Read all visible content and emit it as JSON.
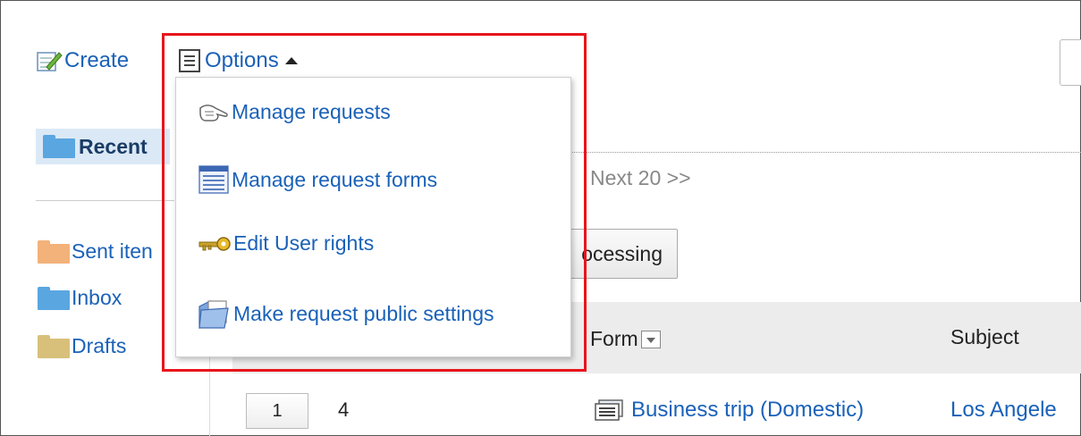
{
  "toolbar": {
    "create_label": "Create",
    "options_label": "Options"
  },
  "options_menu": {
    "items": [
      {
        "label": "Manage requests",
        "icon": "hand-pointer-icon"
      },
      {
        "label": "Manage request forms",
        "icon": "form-icon"
      },
      {
        "label": "Edit User rights",
        "icon": "key-icon"
      },
      {
        "label": "Make request public settings",
        "icon": "public-folder-icon"
      }
    ]
  },
  "sidebar": {
    "selected": "Recent",
    "items": [
      {
        "label": "Sent iten",
        "icon": "orange-folder-icon"
      },
      {
        "label": "Inbox",
        "icon": "blue-folder-icon"
      },
      {
        "label": "Drafts",
        "icon": "tan-folder-icon"
      }
    ]
  },
  "main": {
    "next_label": "Next 20 >>",
    "processing_label": "ocessing",
    "columns": {
      "form": "Form",
      "subject": "Subject"
    },
    "rows": [
      {
        "number": "1",
        "count": "4",
        "form": "Business trip (Domestic)",
        "subject": "Los Angele"
      }
    ]
  },
  "colors": {
    "link": "#1a61b8",
    "highlight_border": "#e8151b",
    "selected_bg": "#dbe9f6",
    "header_bg": "#ececec"
  }
}
